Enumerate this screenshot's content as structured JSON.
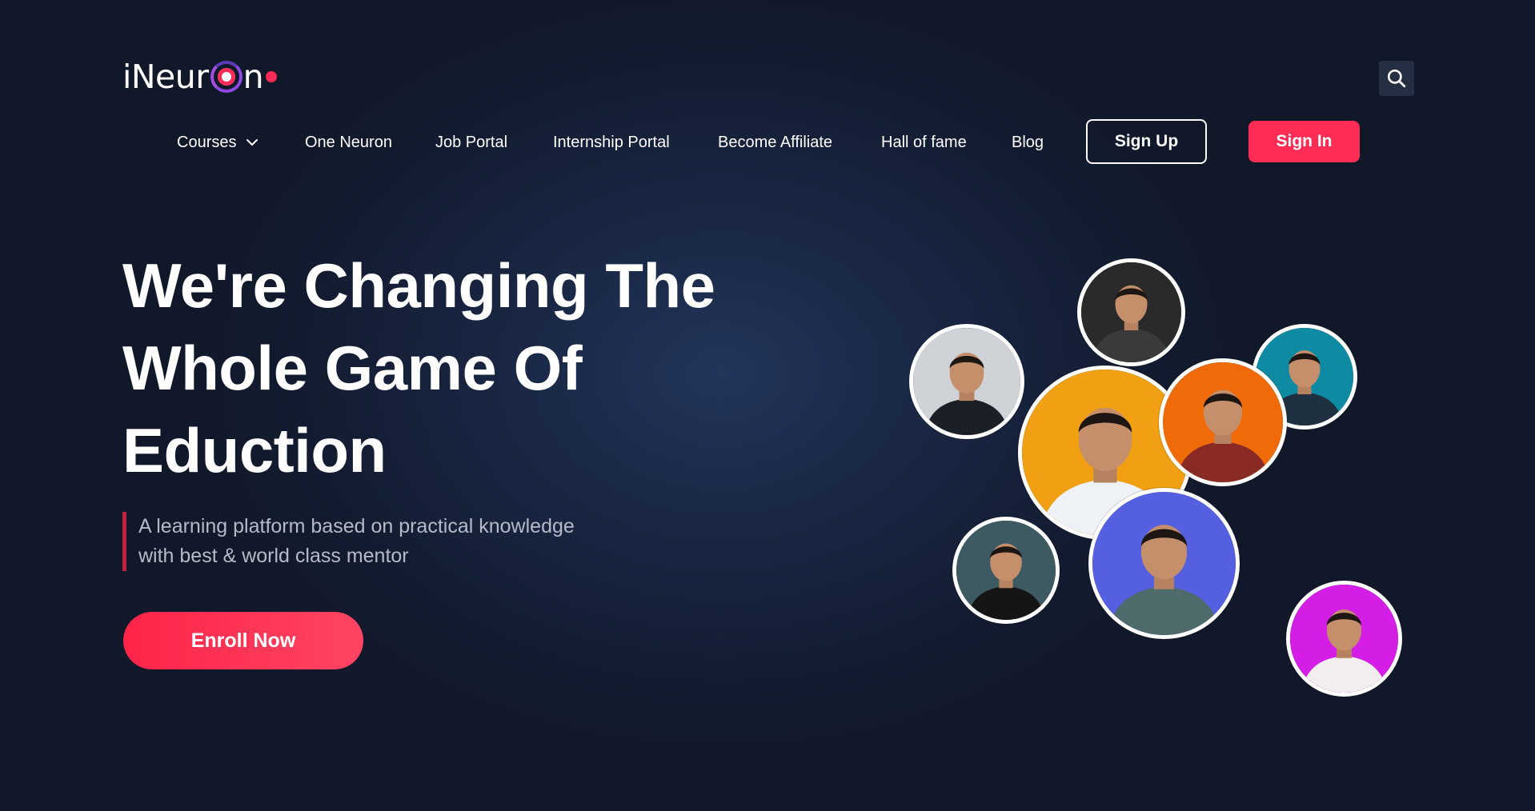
{
  "brand": {
    "logo_prefix": "iNeur",
    "logo_suffix": "n",
    "accent": "#ff2d55",
    "background": "#131b30"
  },
  "header": {
    "search_icon": "search-icon"
  },
  "nav": {
    "items": [
      {
        "label": "Courses",
        "has_dropdown": true
      },
      {
        "label": "One Neuron"
      },
      {
        "label": "Job Portal"
      },
      {
        "label": "Internship Portal"
      },
      {
        "label": "Become Affiliate"
      },
      {
        "label": "Hall of fame"
      },
      {
        "label": "Blog"
      }
    ],
    "signup_label": "Sign Up",
    "signin_label": "Sign In"
  },
  "hero": {
    "title_line1": "We're Changing The",
    "title_line2": "Whole Game Of",
    "title_line3": "Eduction",
    "subtitle_line1": "A learning platform based on practical knowledge",
    "subtitle_line2": "with best & world class mentor",
    "cta_label": "Enroll Now"
  },
  "mentors": [
    {
      "bg": "#2a2a2a",
      "shirt": "#3a3a3a"
    },
    {
      "bg": "#cfd3d8",
      "shirt": "#1b1f26"
    },
    {
      "bg": "#0f8aa3",
      "shirt": "#1f3040"
    },
    {
      "bg": "#f0a012",
      "shirt": "#eef2f6"
    },
    {
      "bg": "#ef6b0a",
      "shirt": "#8a2a25"
    },
    {
      "bg": "#3d5a63",
      "shirt": "#151515"
    },
    {
      "bg": "#5560e0",
      "shirt": "#4e6a6a"
    },
    {
      "bg": "#d41ee6",
      "shirt": "#f2eef0"
    }
  ]
}
